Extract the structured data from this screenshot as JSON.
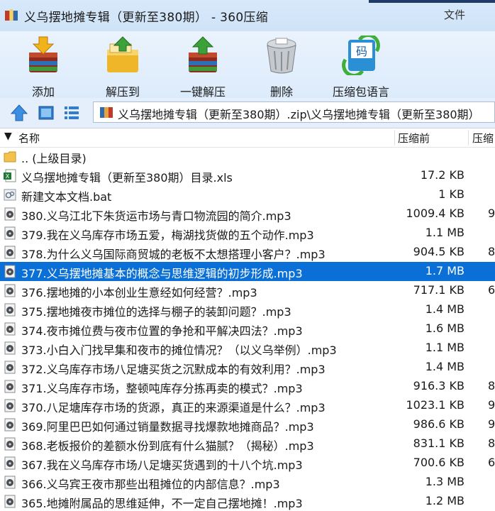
{
  "window": {
    "title": "义乌摆地摊专辑（更新至380期）  - 360压缩",
    "menu_file": "文件"
  },
  "toolbar": [
    {
      "label": "添加",
      "icon": "add-archive-icon"
    },
    {
      "label": "解压到",
      "icon": "extract-to-icon"
    },
    {
      "label": "一键解压",
      "icon": "one-click-extract-icon"
    },
    {
      "label": "删除",
      "icon": "delete-trash-icon"
    },
    {
      "label": "压缩包语言",
      "icon": "archive-language-icon"
    }
  ],
  "nav": {
    "path": "义乌摆地摊专辑（更新至380期）.zip\\义乌摆地摊专辑（更新至380期）"
  },
  "columns": {
    "sort_arrow": "▼",
    "name": "名称",
    "size_before": "压缩前",
    "size_after": "压缩"
  },
  "files": [
    {
      "name": ".. (上级目录)",
      "size": "",
      "post": "",
      "type": "folder"
    },
    {
      "name": "义乌摆地摊专辑（更新至380期）目录.xls",
      "size": "17.2 KB",
      "post": "",
      "type": "xls"
    },
    {
      "name": "新建文本文档.bat",
      "size": "1 KB",
      "post": "",
      "type": "bat"
    },
    {
      "name": "380.义乌江北下朱货运市场与青口物流园的简介.mp3",
      "size": "1009.4 KB",
      "post": "9",
      "type": "mp3"
    },
    {
      "name": "379.我在义乌库存市场五爱，梅湖找货做的五个动作.mp3",
      "size": "1.1 MB",
      "post": "",
      "type": "mp3"
    },
    {
      "name": "378.为什么义乌国际商贸城的老板不太想搭理小客户？.mp3",
      "size": "904.5 KB",
      "post": "8",
      "type": "mp3"
    },
    {
      "name": "377.义乌摆地摊基本的概念与思维逻辑的初步形成.mp3",
      "size": "1.7 MB",
      "post": "",
      "type": "mp3",
      "selected": true
    },
    {
      "name": "376.摆地摊的小本创业生意经如何经营？.mp3",
      "size": "717.1 KB",
      "post": "6",
      "type": "mp3"
    },
    {
      "name": "375.摆地摊夜市摊位的选择与棚子的装卸问题？.mp3",
      "size": "1.4 MB",
      "post": "",
      "type": "mp3"
    },
    {
      "name": "374.夜市摊位费与夜市位置的争抢和平解决四法？.mp3",
      "size": "1.6 MB",
      "post": "",
      "type": "mp3"
    },
    {
      "name": "373.小白入门找早集和夜市的摊位情况？（以义乌举例）.mp3",
      "size": "1.1 MB",
      "post": "",
      "type": "mp3"
    },
    {
      "name": "372.义乌库存市场八足塘买货之沉默成本的有效利用？.mp3",
      "size": "1.4 MB",
      "post": "",
      "type": "mp3"
    },
    {
      "name": "371.义乌库存市场，整顿吨库存分拣再卖的模式？.mp3",
      "size": "916.3 KB",
      "post": "8",
      "type": "mp3"
    },
    {
      "name": "370.八足塘库存市场的货源，真正的来源渠道是什么？.mp3",
      "size": "1023.1 KB",
      "post": "9",
      "type": "mp3"
    },
    {
      "name": "369.阿里巴巴如何通过销量数据寻找爆款地摊商品？.mp3",
      "size": "986.6 KB",
      "post": "9",
      "type": "mp3"
    },
    {
      "name": "368.老板报价的差额水份到底有什么猫腻？（揭秘）.mp3",
      "size": "831.1 KB",
      "post": "8",
      "type": "mp3"
    },
    {
      "name": "367.我在义乌库存市场八足塘买货遇到的十八个坑.mp3",
      "size": "700.6 KB",
      "post": "6",
      "type": "mp3"
    },
    {
      "name": "366.义乌宾王夜市那些出租摊位的内部信息？.mp3",
      "size": "1.3 MB",
      "post": "",
      "type": "mp3"
    },
    {
      "name": "365.地摊附属品的思维延伸，不一定自己摆地摊！.mp3",
      "size": "1.2 MB",
      "post": "",
      "type": "mp3"
    }
  ],
  "colors": {
    "selection": "#0a6fd6",
    "toolbar_bg": "#dcebfb",
    "title_bg": "#d7e8fa"
  }
}
